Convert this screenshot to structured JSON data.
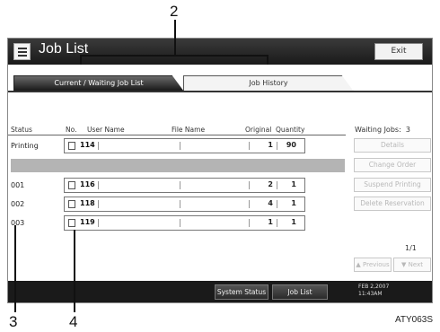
{
  "callouts": {
    "c2": "2",
    "c3": "3",
    "c4": "4"
  },
  "window": {
    "title": "Job List",
    "exit_label": "Exit"
  },
  "tabs": [
    {
      "label": "Current / Waiting Job List",
      "active": true
    },
    {
      "label": "Job History",
      "active": false
    }
  ],
  "table": {
    "headers": {
      "status": "Status",
      "no": "No.",
      "user_name": "User Name",
      "file_name": "File Name",
      "original": "Original",
      "quantity": "Quantity"
    },
    "rows": [
      {
        "status": "Printing",
        "no": "114",
        "original": "1",
        "quantity": "90"
      },
      {
        "status": "001",
        "no": "116",
        "original": "2",
        "quantity": "1"
      },
      {
        "status": "002",
        "no": "118",
        "original": "4",
        "quantity": "1"
      },
      {
        "status": "003",
        "no": "119",
        "original": "1",
        "quantity": "1"
      }
    ]
  },
  "side_panel": {
    "waiting_label": "Waiting Jobs:",
    "waiting_count": "3",
    "buttons": [
      "Details",
      "Change Order",
      "Suspend Printing",
      "Delete Reservation"
    ],
    "page_indicator": "1/1",
    "prev_label": "Previous",
    "next_label": "Next"
  },
  "bottom_bar": {
    "system_status": "System Status",
    "job_list": "Job List",
    "date": "FEB  2,2007",
    "time": "11:43AM"
  },
  "figure_id": "ATY063S"
}
